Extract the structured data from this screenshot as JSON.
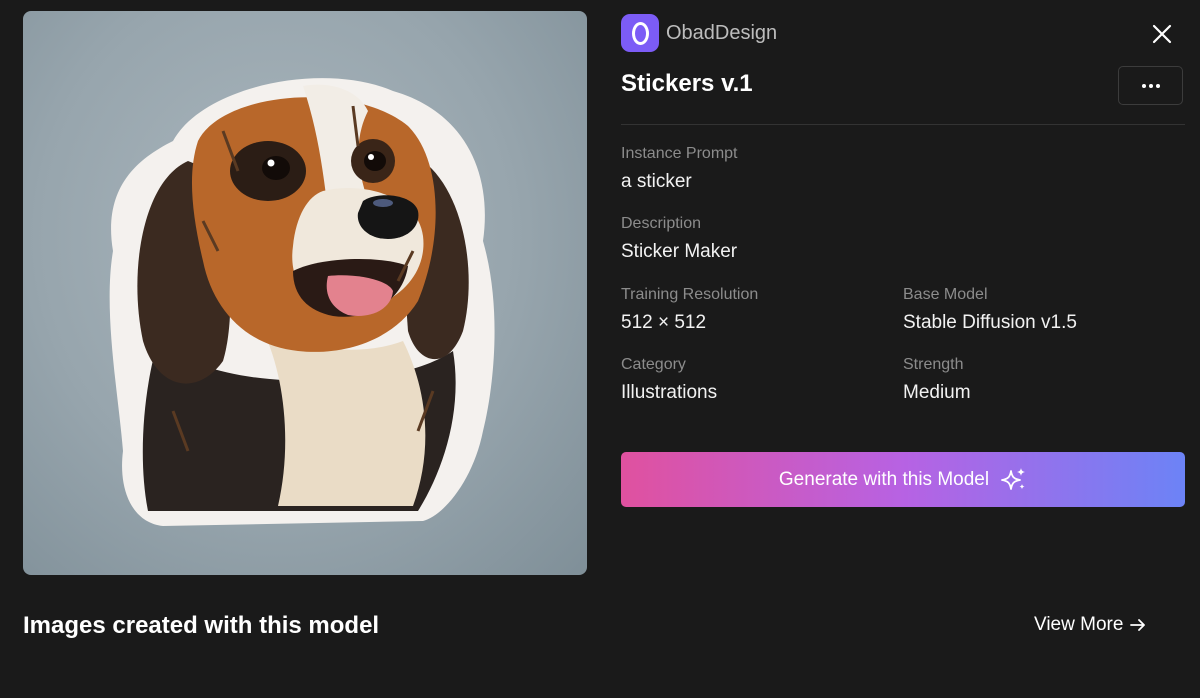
{
  "author": {
    "name": "ObadDesign",
    "logo_letter": "O",
    "logo_color": "#7c5cf6"
  },
  "model": {
    "title": "Stickers v.1"
  },
  "preview": {
    "alt": "dog sticker"
  },
  "fields": {
    "instance_prompt": {
      "label": "Instance Prompt",
      "value": "a sticker"
    },
    "description": {
      "label": "Description",
      "value": "Sticker Maker"
    },
    "training_resolution": {
      "label": "Training Resolution",
      "value": "512 × 512"
    },
    "base_model": {
      "label": "Base Model",
      "value": "Stable Diffusion v1.5"
    },
    "category": {
      "label": "Category",
      "value": "Illustrations"
    },
    "strength": {
      "label": "Strength",
      "value": "Medium"
    }
  },
  "actions": {
    "generate_label": "Generate with this Model",
    "view_more_label": "View More"
  },
  "gallery": {
    "title": "Images created with this model"
  },
  "icons": {
    "close": "close-icon",
    "more": "more-icon",
    "sparkle": "sparkle-icon",
    "arrow": "arrow-right-icon"
  },
  "colors": {
    "background": "#1a1a1a",
    "gradient_start": "#e0519f",
    "gradient_end": "#6c83f6",
    "muted_text": "#8c8c8c"
  }
}
